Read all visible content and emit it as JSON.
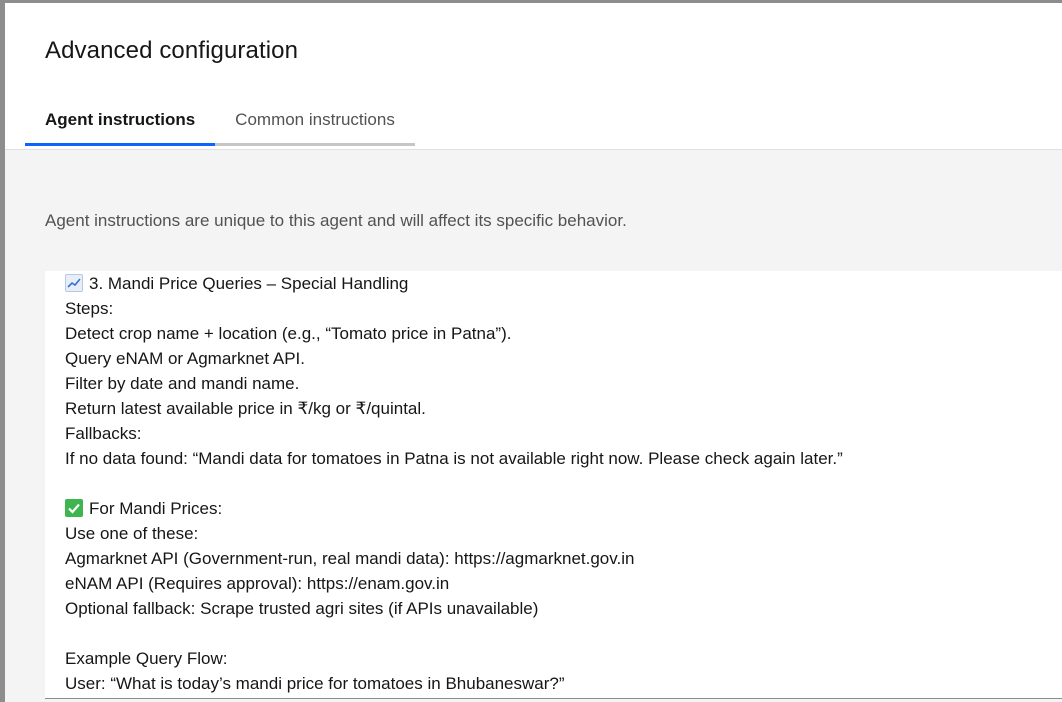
{
  "dialog": {
    "title": "Advanced configuration"
  },
  "tabs": [
    {
      "label": "Agent instructions",
      "active": true
    },
    {
      "label": "Common instructions",
      "active": false
    }
  ],
  "description": "Agent instructions are unique to this agent and will affect its specific behavior.",
  "editor": {
    "lines": [
      {
        "text": "3. Mandi Price Queries – Special Handling",
        "icon": "chart-increasing-icon"
      },
      {
        "text": "Steps:"
      },
      {
        "text": "Detect crop name + location (e.g., “Tomato price in Patna”)."
      },
      {
        "text": "Query eNAM or Agmarknet API."
      },
      {
        "text": "Filter by date and mandi name."
      },
      {
        "text": "Return latest available price in ₹/kg or ₹/quintal."
      },
      {
        "text": "Fallbacks:"
      },
      {
        "text": "If no data found: “Mandi data for tomatoes in Patna is not available right now. Please check again later.”"
      },
      {
        "text": ""
      },
      {
        "text": "For Mandi Prices:",
        "icon": "check-mark-icon"
      },
      {
        "text": "Use one of these:"
      },
      {
        "text": "Agmarknet API (Government-run, real mandi data): https://agmarknet.gov.in"
      },
      {
        "text": "eNAM API (Requires approval): https://enam.gov.in"
      },
      {
        "text": "Optional fallback: Scrape trusted agri sites (if APIs unavailable)"
      },
      {
        "text": ""
      },
      {
        "text": "Example Query Flow:"
      },
      {
        "text": "User: “What is today’s mandi price for tomatoes in Bhubaneswar?”"
      }
    ]
  },
  "colors": {
    "accent": "#0f62fe",
    "content_bg": "#f4f4f4",
    "check_green": "#3fb54f"
  }
}
